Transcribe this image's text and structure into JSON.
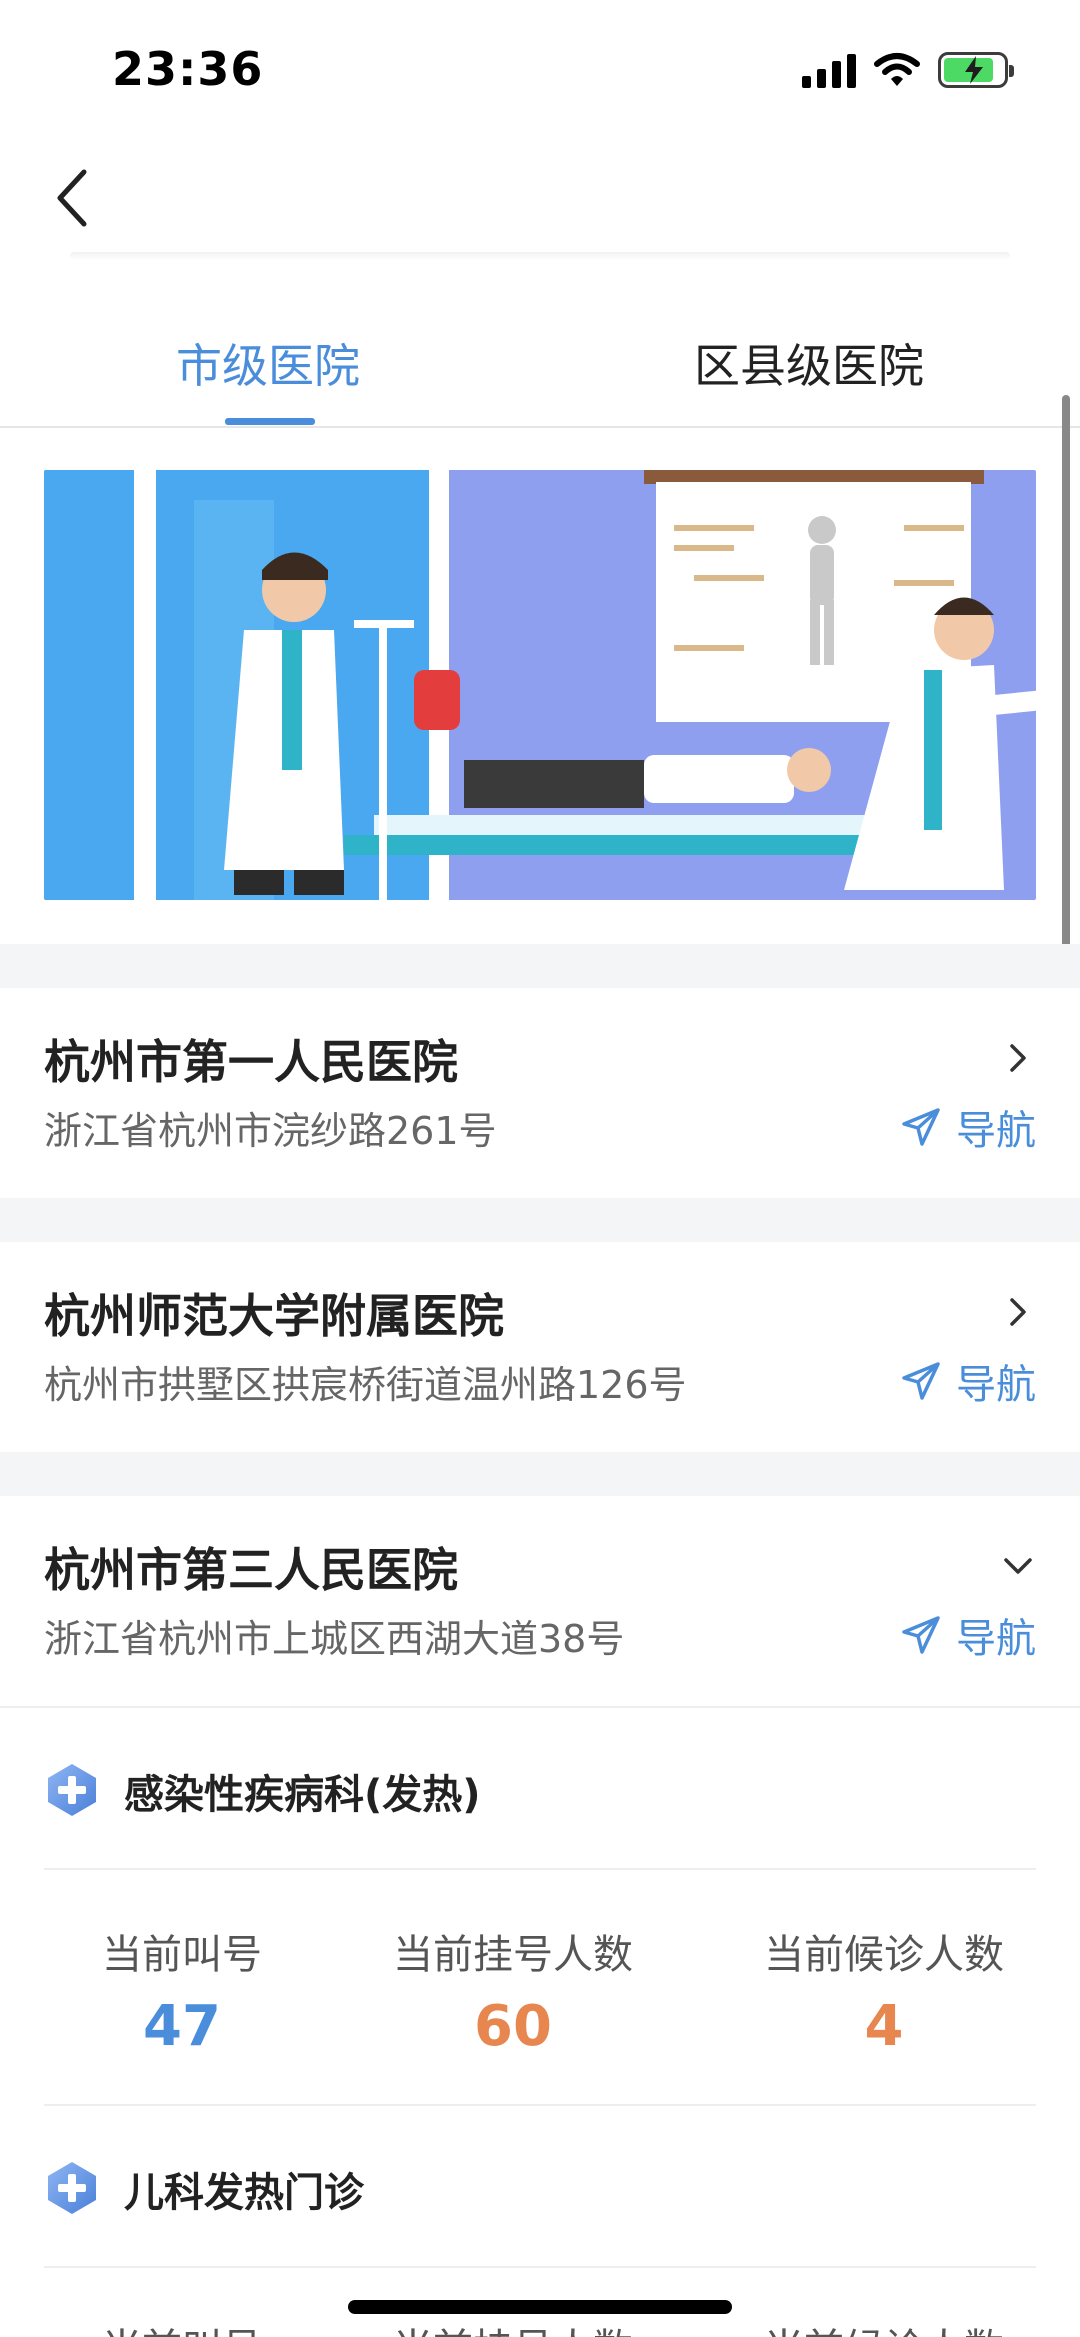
{
  "status_bar": {
    "time": "23:36"
  },
  "tabs": [
    {
      "label": "市级医院",
      "active": true
    },
    {
      "label": "区县级医院",
      "active": false
    }
  ],
  "hospitals": [
    {
      "name": "杭州市第一人民医院",
      "address": "浙江省杭州市浣纱路261号",
      "nav_label": "导航",
      "chevron": "chevron-right-icon"
    },
    {
      "name": "杭州师范大学附属医院",
      "address": "杭州市拱墅区拱宸桥街道温州路126号",
      "nav_label": "导航",
      "chevron": "chevron-right-icon"
    },
    {
      "name": "杭州市第三人民医院",
      "address": "浙江省杭州市上城区西湖大道38号",
      "nav_label": "导航",
      "chevron": "chevron-down-icon"
    }
  ],
  "departments": [
    {
      "name": "感染性疾病科(发热)",
      "stats": [
        {
          "label": "当前叫号",
          "value": "47",
          "color": "#4a8edb"
        },
        {
          "label": "当前挂号人数",
          "value": "60",
          "color": "#e8864f"
        },
        {
          "label": "当前候诊人数",
          "value": "4",
          "color": "#e8864f"
        }
      ]
    },
    {
      "name": "儿科发热门诊",
      "stats": [
        {
          "label": "当前叫号"
        },
        {
          "label": "当前挂号人数"
        },
        {
          "label": "当前候诊人数"
        }
      ]
    }
  ],
  "colors": {
    "accent": "#4a8edb",
    "orange": "#e8864f"
  }
}
